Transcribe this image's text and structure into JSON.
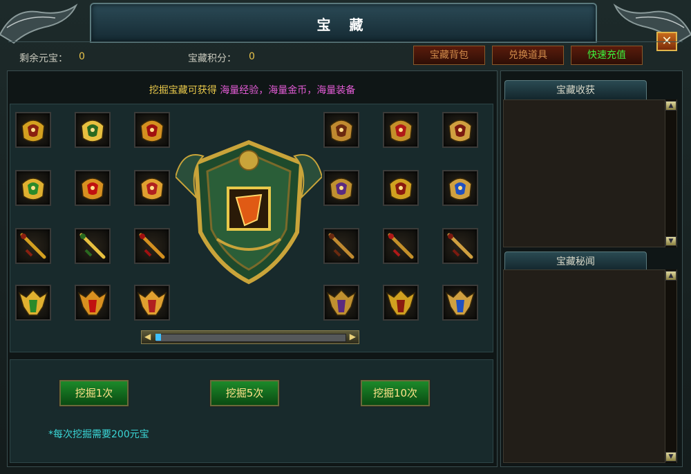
{
  "window": {
    "title": "宝 藏",
    "close_label": "✕"
  },
  "info": {
    "remaining_label": "剩余元宝：",
    "remaining_value": "0",
    "points_label": "宝藏积分：",
    "points_value": "0"
  },
  "top_buttons": {
    "bag": "宝藏背包",
    "exchange": "兑换道具",
    "recharge": "快速充值"
  },
  "headline": {
    "prefix": "挖掘宝藏可获得",
    "rewards": "海量经验，海量金币，海量装备"
  },
  "dig_buttons": [
    "挖掘1次",
    "挖掘5次",
    "挖掘10次"
  ],
  "note": "*每次挖掘需要200元宝",
  "right_tabs": [
    "宝藏收获",
    "宝藏秘闻"
  ],
  "reward_items": [
    {
      "icon": "helmet-gold-icon"
    },
    {
      "icon": "necklace-gold-icon"
    },
    {
      "icon": "armor-gold-icon"
    },
    {
      "icon": "dragon-helmet-icon"
    },
    {
      "icon": "red-armor-icon"
    },
    {
      "icon": "dragon-mask-icon"
    },
    {
      "icon": "green-helmet-icon"
    },
    {
      "icon": "red-crown-icon"
    },
    {
      "icon": "phoenix-armor-icon"
    },
    {
      "icon": "phoenix-necklace-icon"
    },
    {
      "icon": "serpent-bracer-icon"
    },
    {
      "icon": "blue-armor-icon"
    },
    {
      "icon": "jade-sword-icon"
    },
    {
      "icon": "ruby-staff-icon"
    },
    {
      "icon": "gold-spear-icon"
    },
    {
      "icon": "flame-sword-icon"
    },
    {
      "icon": "gold-mace-icon"
    },
    {
      "icon": "blue-sword-icon"
    },
    {
      "icon": "winged-robe-icon"
    },
    {
      "icon": "winged-robe-2-icon"
    },
    {
      "icon": "dragon-armor-icon"
    },
    {
      "icon": "blue-winged-armor-icon"
    },
    {
      "icon": "blue-winged-armor-2-icon"
    },
    {
      "icon": "blue-winged-armor-3-icon"
    }
  ],
  "colors": {
    "gold_text": "#e8c84a",
    "pink_text": "#e45cd6",
    "note_text": "#3ad6d6",
    "recharge_text": "#3cf03c",
    "dig_button": "#1c8a2a"
  },
  "scroll_position": 0
}
